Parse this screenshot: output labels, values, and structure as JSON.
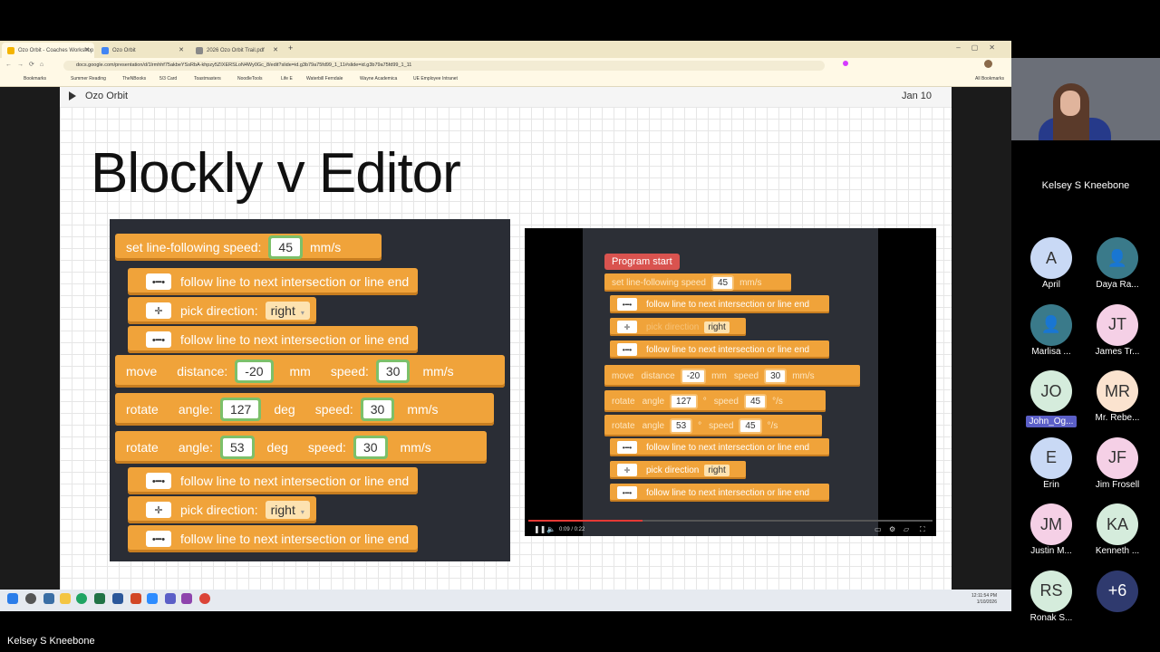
{
  "browser": {
    "tabs": [
      {
        "label": "Ozo Orbit - Coaches Workshop"
      },
      {
        "label": "Ozo Orbit"
      },
      {
        "label": "2026 Ozo Orbit Trail.pdf"
      }
    ],
    "url": "docs.google.com/presentation/d/1lrmhhf75akbeYSsRbA-khpzy5ZIXERSLoN4Wy0Gc_8/edit?slide=id.g3b79a75fd99_1_11#slide=id.g3b79a75fd99_1_11",
    "bookmarks": [
      "Bookmarks",
      "Summer Reading",
      "TheNBooks",
      "5/3 Card",
      "Toastmasters",
      "NoodleTools",
      "Life E",
      "Waterbill Ferndale",
      "Wayne Academica",
      "UE Employee Intranet"
    ],
    "all_bookmarks": "All Bookmarks"
  },
  "slide": {
    "name": "Ozo Orbit",
    "date": "Jan 10",
    "title": "Blockly v Editor"
  },
  "blockly_left": {
    "b1_label": "set line-following speed:",
    "b1_value": "45",
    "b1_unit": "mm/s",
    "follow_label": "follow line to next intersection or line end",
    "pick_label": "pick direction:",
    "pick_value": "right",
    "move_label": "move",
    "distance_label": "distance:",
    "move_distance": "-20",
    "mm": "mm",
    "speed_label": "speed:",
    "move_speed": "30",
    "mms": "mm/s",
    "rotate_label": "rotate",
    "angle_label": "angle:",
    "rot1_angle": "127",
    "deg": "deg",
    "rot1_speed": "30",
    "rot2_angle": "53",
    "rot2_speed": "30"
  },
  "video": {
    "program_start": "Program start",
    "set_speed": "set line-following speed",
    "speed_value": "45",
    "unit": "mm/s",
    "follow": "follow line to next intersection or line end",
    "pick_direction": "pick direction",
    "right": "right",
    "move": "move",
    "distance": "distance",
    "dist_value": "-20",
    "mm": "mm",
    "speed": "speed",
    "move_speed": "30",
    "rotate": "rotate",
    "angle": "angle",
    "angle1": "127",
    "deg_sym": "°",
    "rot_speed1": "45",
    "deg_s": "°/s",
    "angle2": "53",
    "rot_speed2": "45",
    "time": "0:09 / 0:22"
  },
  "taskbar": {
    "time": "12:11:54 PM",
    "date": "1/10/2026"
  },
  "meeting": {
    "speaker": "Kelsey S Kneebone",
    "participants": [
      {
        "initials": "A",
        "name": "April",
        "color": "#c9d9f5"
      },
      {
        "initials": "",
        "name": "Daya Ra...",
        "color": "#3a7a8a"
      },
      {
        "initials": "",
        "name": "Marlisa ...",
        "color": "#3a7a8a"
      },
      {
        "initials": "JT",
        "name": "James Tr...",
        "color": "#f5d0e6"
      },
      {
        "initials": "JO",
        "name": "John_Og...",
        "color": "#d5ecdc"
      },
      {
        "initials": "MR",
        "name": "Mr. Rebe...",
        "color": "#fbe3cf"
      },
      {
        "initials": "E",
        "name": "Erin",
        "color": "#c9d9f5"
      },
      {
        "initials": "JF",
        "name": "Jim Frosell",
        "color": "#f5d0e6"
      },
      {
        "initials": "JM",
        "name": "Justin M...",
        "color": "#f5d0e6"
      },
      {
        "initials": "KA",
        "name": "Kenneth ...",
        "color": "#d5ecdc"
      },
      {
        "initials": "RS",
        "name": "Ronak S...",
        "color": "#d5ecdc"
      },
      {
        "initials": "+6",
        "name": "",
        "color": "#2f3a6e"
      }
    ],
    "bottom_name": "Kelsey S Kneebone"
  }
}
